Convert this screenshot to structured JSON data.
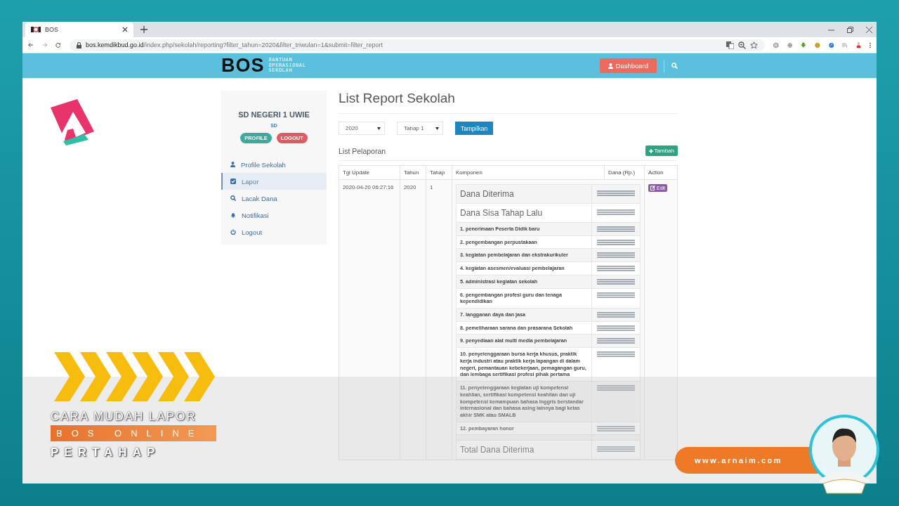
{
  "browser": {
    "tab": {
      "title": "BOS"
    },
    "url": {
      "host": "bos.kemdikbud.go.id",
      "path": "/index.php/sekolah/reporting?filter_tahun=2020&filter_triwulan=1&submit=filter_report"
    }
  },
  "header": {
    "logo": {
      "text": "BOS",
      "subtitle": [
        "BANTUAN",
        "OPERASIONAL",
        "SEKOLAH"
      ]
    },
    "dashboard_button": "Dashboard"
  },
  "sidebar": {
    "school": "SD NEGERI 1 UWIE",
    "level": "SD",
    "buttons": [
      {
        "label": "PROFILE",
        "kind": "profile"
      },
      {
        "label": "LOGOUT",
        "kind": "logout"
      }
    ],
    "items": [
      {
        "label": "Profile Sekolah",
        "selected": false
      },
      {
        "label": "Lapor",
        "selected": true
      },
      {
        "label": "Lacak Dana",
        "selected": false
      },
      {
        "label": "Notifikasi",
        "selected": false
      },
      {
        "label": "Logout",
        "selected": false
      }
    ]
  },
  "main": {
    "title": "List Report Sekolah",
    "filters": [
      {
        "value": "2020"
      },
      {
        "value": "Tahap 1"
      }
    ],
    "submit": "Tampilkan",
    "section_title": "List Pelaporan",
    "add_button": "Tambah",
    "table": {
      "columns": [
        "Tgl Update",
        "Tahun",
        "Tahap",
        "Komponen",
        "Dana (Rp.)",
        "Action"
      ],
      "rows": [
        {
          "tgl_update": "2020-04-20 06:27:16",
          "tahun": "2020",
          "tahap": "1",
          "action": "Edit",
          "komponen": [
            {
              "kind": "heading",
              "label": "Dana Diterima"
            },
            {
              "kind": "heading",
              "label": "Dana Sisa Tahap Lalu"
            },
            {
              "kind": "item",
              "label": "1. penerimaan Peserta Didik baru"
            },
            {
              "kind": "item",
              "label": "2. pengembangan perpustakaan"
            },
            {
              "kind": "item",
              "label": "3. kegiatan pembelajaran dan ekstrakurikuler"
            },
            {
              "kind": "item",
              "label": "4. kegiatan asesmen/evaluasi pembelajaran"
            },
            {
              "kind": "item",
              "label": "5. administrasi kegiatan sekolah"
            },
            {
              "kind": "item",
              "label": "6. pengembangan profesi guru dan tenaga kependidikan"
            },
            {
              "kind": "item",
              "label": "7. langganan daya dan jasa"
            },
            {
              "kind": "item",
              "label": "8. pemeliharaan sarana dan prasarana Sekolah"
            },
            {
              "kind": "item",
              "label": "9. penyediaan alat multi media pembelajaran"
            },
            {
              "kind": "item",
              "label": "10. penyelenggaraan bursa kerja khusus, praktik kerja industri atau praktik kerja lapangan di dalam negeri, pemantauan kebekerjaan, pemagangan guru, dan lembaga sertifikasi profesi pihak pertama"
            },
            {
              "kind": "item",
              "label": "11. penyelenggaraan kegiatan uji kompetensi keahlian, sertifikasi kompetensi keahlian dan uji kompetensi kemampuan bahasa Inggris berstandar internasional dan bahasa asing lainnya bagi kelas akhir SMK atau SMALB"
            },
            {
              "kind": "item",
              "label": "12. pembayaran honor"
            },
            {
              "kind": "spacer"
            },
            {
              "kind": "heading",
              "label": "Total Dana Diterima"
            }
          ]
        }
      ]
    }
  },
  "overlay": {
    "title_lines": [
      "CARA MUDAH LAPOR",
      "BOS ONLINE",
      "PERTAHAP"
    ],
    "website": "www.arnaim.com"
  }
}
